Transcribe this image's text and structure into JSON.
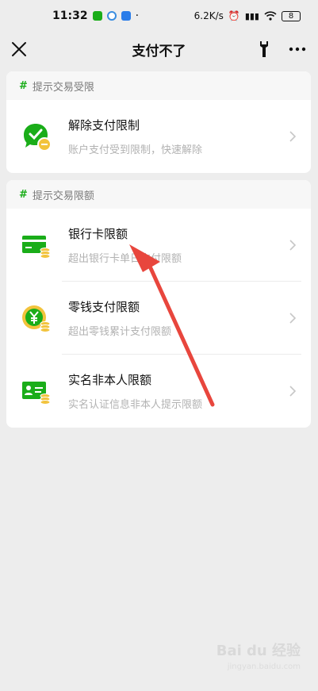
{
  "status": {
    "time": "11:32",
    "network_speed": "6.2K/s",
    "battery": "8"
  },
  "nav": {
    "title": "支付不了",
    "close_icon": "close-icon",
    "tool_icon": "wrench-icon",
    "more_icon": "more-icon"
  },
  "section1": {
    "header": "提示交易受限",
    "items": [
      {
        "title": "解除支付限制",
        "subtitle": "账户支付受到限制，快速解除",
        "icon": "chat-unlock-icon"
      }
    ]
  },
  "section2": {
    "header": "提示交易限额",
    "items": [
      {
        "title": "银行卡限额",
        "subtitle": "超出银行卡单日支付限额",
        "icon": "bank-card-icon"
      },
      {
        "title": "零钱支付限额",
        "subtitle": "超出零钱累计支付限额",
        "icon": "change-yuan-icon"
      },
      {
        "title": "实名非本人限额",
        "subtitle": "实名认证信息非本人提示限额",
        "icon": "id-card-icon"
      }
    ]
  },
  "colors": {
    "accent_green": "#1aad19",
    "coin_yellow": "#f2c33c",
    "arrow_red": "#e8463d"
  },
  "watermark": {
    "brand": "Bai du 经验",
    "url": "jingyan.baidu.com"
  }
}
